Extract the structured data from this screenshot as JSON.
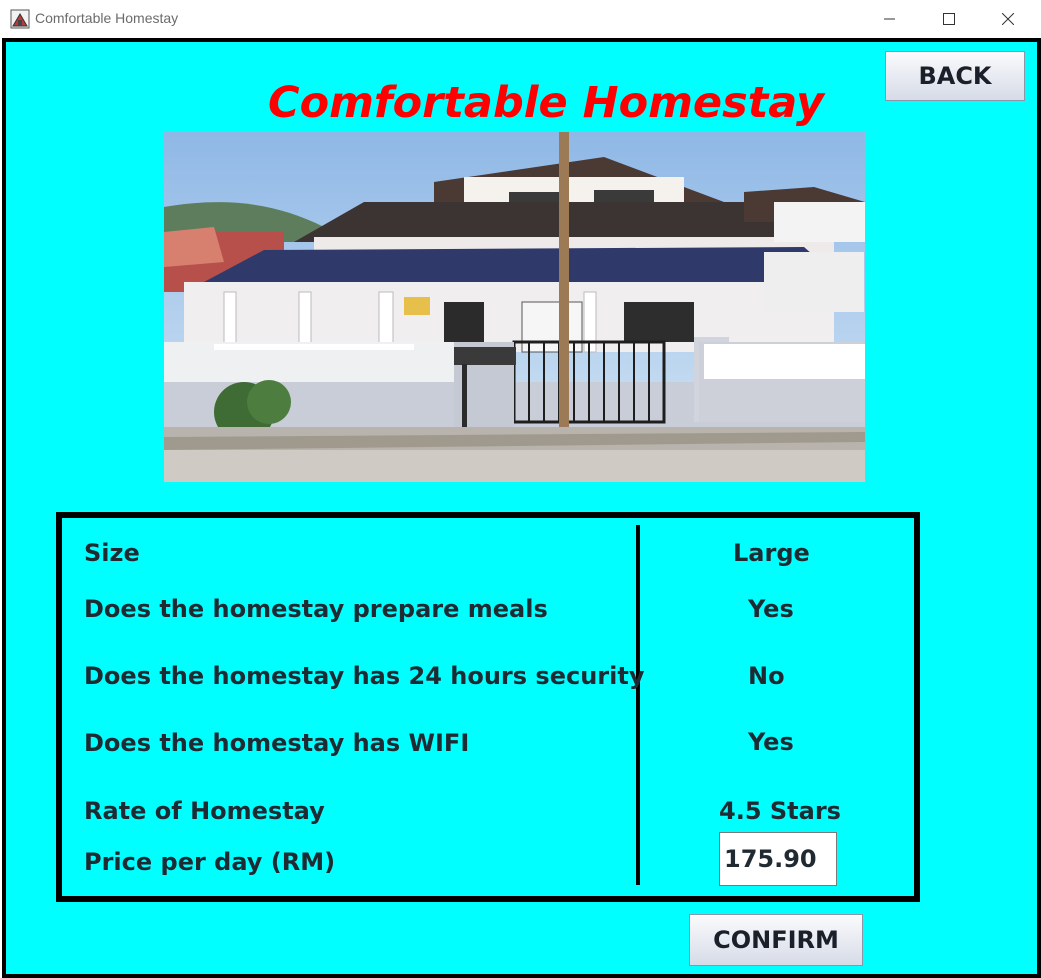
{
  "window": {
    "title": "Comfortable Homestay",
    "controls": [
      "minimize-icon",
      "maximize-icon",
      "close-icon"
    ]
  },
  "header": {
    "heading": "Comfortable Homestay",
    "back_label": "BACK"
  },
  "photo": {
    "subject": "homestay-house-photo"
  },
  "details": [
    {
      "label": "Size",
      "value": "Large"
    },
    {
      "label": "Does the homestay prepare meals",
      "value": "Yes"
    },
    {
      "label": "Does the homestay has 24 hours security",
      "value": "No"
    },
    {
      "label": "Does the homestay has WIFI",
      "value": "Yes"
    },
    {
      "label": "Rate of Homestay",
      "value": "4.5 Stars"
    },
    {
      "label": "Price per day (RM)",
      "value": "175.90"
    }
  ],
  "actions": {
    "confirm_label": "CONFIRM"
  },
  "colors": {
    "background": "#00ffff",
    "heading": "#ff0000",
    "text": "#1f2a33"
  }
}
